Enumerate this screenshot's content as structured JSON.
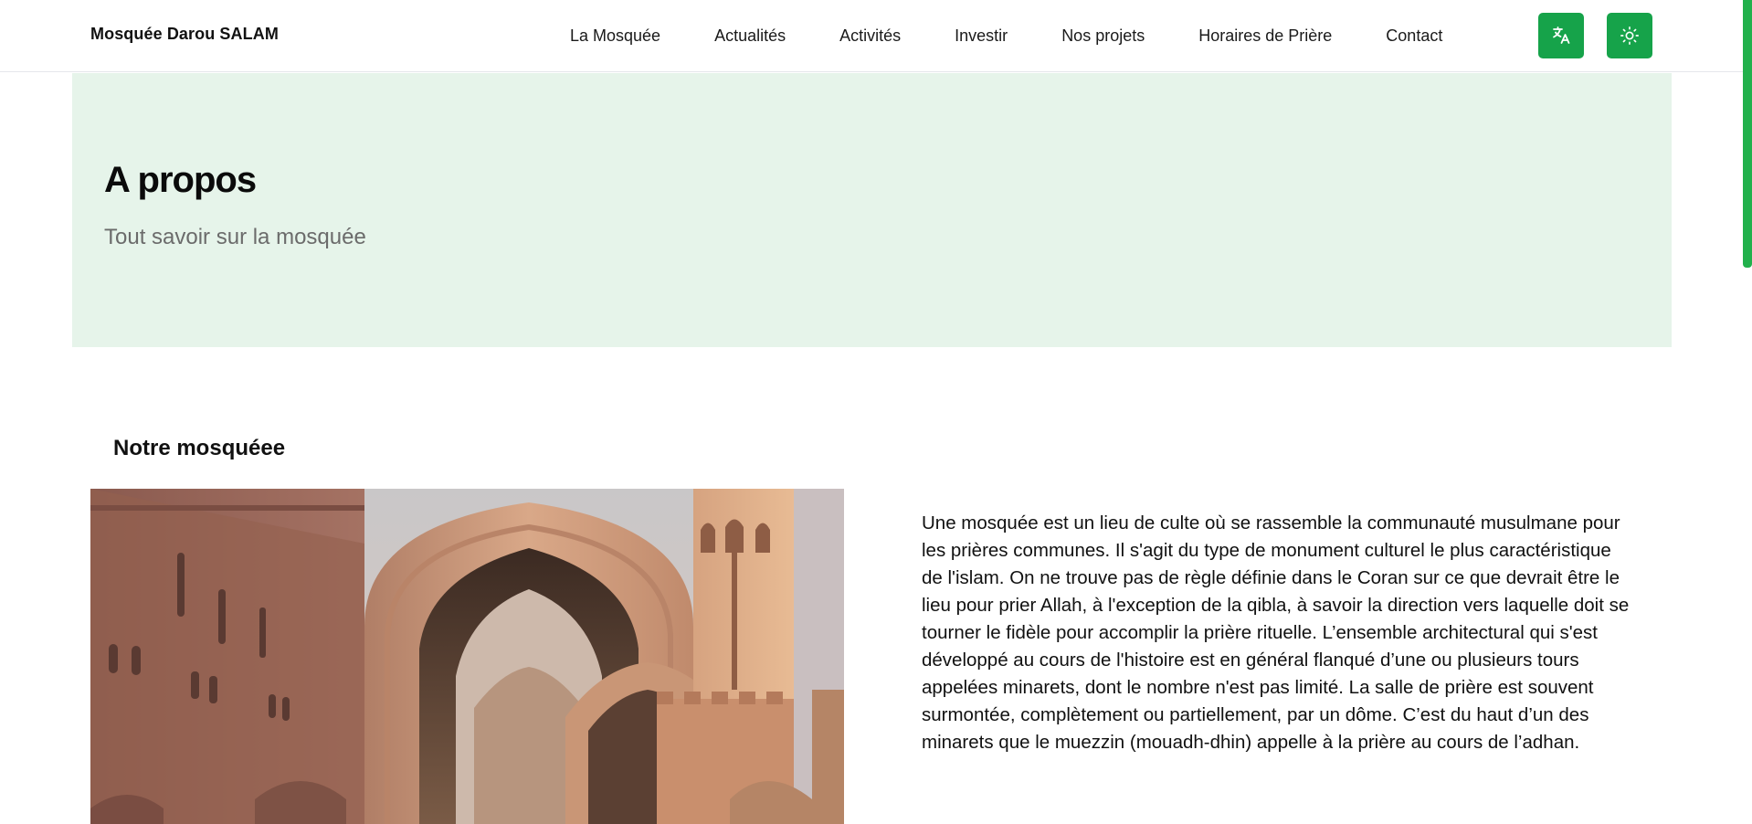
{
  "header": {
    "brand": "Mosquée Darou SALAM",
    "nav": [
      {
        "label": "La Mosquée"
      },
      {
        "label": "Actualités"
      },
      {
        "label": "Activités"
      },
      {
        "label": "Investir"
      },
      {
        "label": "Nos projets"
      },
      {
        "label": "Horaires de Prière"
      },
      {
        "label": "Contact"
      }
    ],
    "translate_icon": "translate-icon",
    "theme_icon": "sun-icon",
    "accent_color": "#16a34a"
  },
  "hero": {
    "title": "A propos",
    "subtitle": "Tout savoir sur la mosquée",
    "background": "#e6f4ea"
  },
  "section": {
    "title": "Notre mosquéee",
    "image_icon": "mosque-image",
    "description": "Une mosquée est un lieu de culte où se rassemble la communauté musulmane pour les prières communes. Il s'agit du type de monument culturel le plus caractéristique de l'islam. On ne trouve pas de règle définie dans le Coran sur ce que devrait être le lieu pour prier Allah, à l'exception de la qibla, à savoir la direction vers laquelle doit se tourner le fidèle pour accomplir la prière rituelle. L’ensemble architectural qui s'est développé au cours de l'histoire est en général flanqué d’une ou plusieurs tours appelées minarets, dont le nombre n'est pas limité. La salle de prière est souvent surmontée, complètement ou partiellement, par un dôme. C’est du haut d’un des minarets que le muezzin (mouadh-dhin) appelle à la prière au cours de l’adhan."
  }
}
